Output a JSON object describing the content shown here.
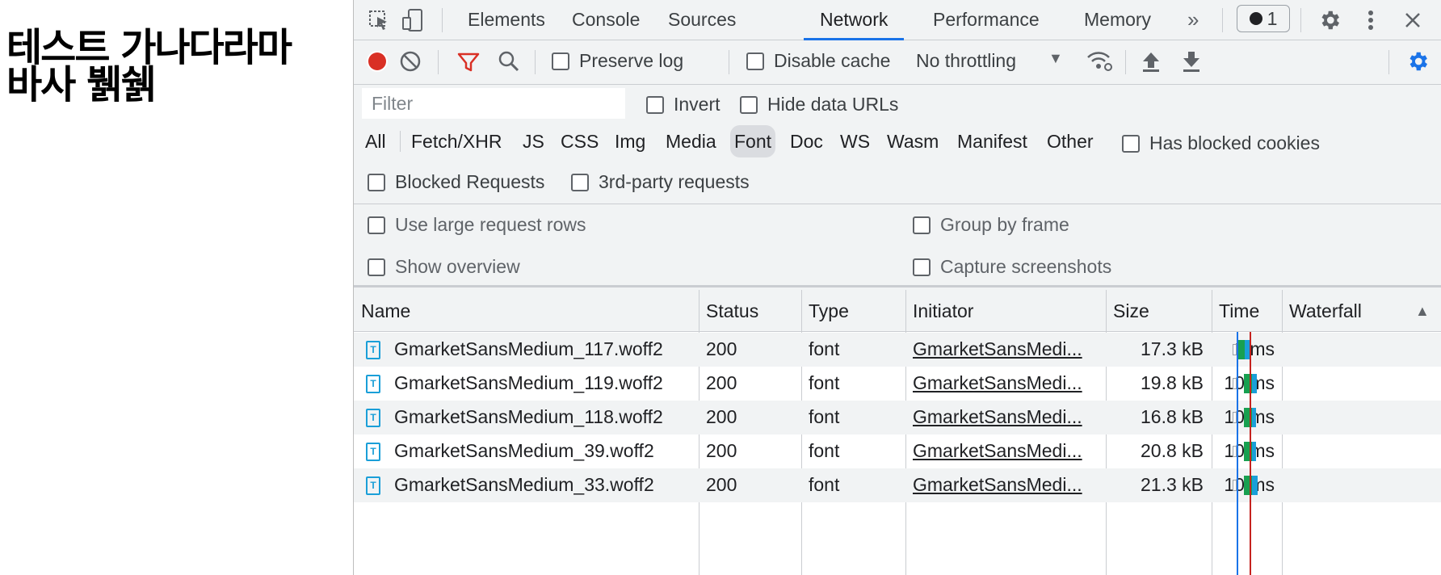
{
  "page": {
    "heading_line1": "테스트 가나다라마",
    "heading_line2": "바사 뷁쉙"
  },
  "devtools": {
    "tabs": [
      "Elements",
      "Console",
      "Sources",
      "Network",
      "Performance",
      "Memory"
    ],
    "active_tab": "Network",
    "more_tabs_icon": "chevron-double-right-icon",
    "issues_count": "1",
    "toolbar": {
      "preserve_log": "Preserve log",
      "disable_cache": "Disable cache",
      "throttling": "No throttling"
    },
    "filter": {
      "placeholder": "Filter",
      "invert": "Invert",
      "hide_data_urls": "Hide data URLs"
    },
    "type_filters": [
      "All",
      "Fetch/XHR",
      "JS",
      "CSS",
      "Img",
      "Media",
      "Font",
      "Doc",
      "WS",
      "Wasm",
      "Manifest",
      "Other"
    ],
    "active_type_filter": "Font",
    "has_blocked_cookies": "Has blocked cookies",
    "blocked_requests": "Blocked Requests",
    "third_party_requests": "3rd-party requests",
    "settings": {
      "use_large_rows": "Use large request rows",
      "group_by_frame": "Group by frame",
      "show_overview": "Show overview",
      "capture_screenshots": "Capture screenshots"
    },
    "columns": {
      "name": "Name",
      "status": "Status",
      "type": "Type",
      "initiator": "Initiator",
      "size": "Size",
      "time": "Time",
      "waterfall": "Waterfall"
    },
    "requests": [
      {
        "name": "GmarketSansMedium_117.woff2",
        "status": "200",
        "type": "font",
        "initiator": "GmarketSansMedi...",
        "size": "17.3 kB",
        "time": "8 ms"
      },
      {
        "name": "GmarketSansMedium_119.woff2",
        "status": "200",
        "type": "font",
        "initiator": "GmarketSansMedi...",
        "size": "19.8 kB",
        "time": "10 ms"
      },
      {
        "name": "GmarketSansMedium_118.woff2",
        "status": "200",
        "type": "font",
        "initiator": "GmarketSansMedi...",
        "size": "16.8 kB",
        "time": "10 ms"
      },
      {
        "name": "GmarketSansMedium_39.woff2",
        "status": "200",
        "type": "font",
        "initiator": "GmarketSansMedi...",
        "size": "20.8 kB",
        "time": "10 ms"
      },
      {
        "name": "GmarketSansMedium_33.woff2",
        "status": "200",
        "type": "font",
        "initiator": "GmarketSansMedi...",
        "size": "21.3 kB",
        "time": "10 ms"
      }
    ],
    "colors": {
      "accent": "#1a73e8",
      "record": "#d93025",
      "filter_active": "#d93025",
      "waterfall_receiving": "#18a050",
      "waterfall_download": "#1a9fd8"
    }
  }
}
